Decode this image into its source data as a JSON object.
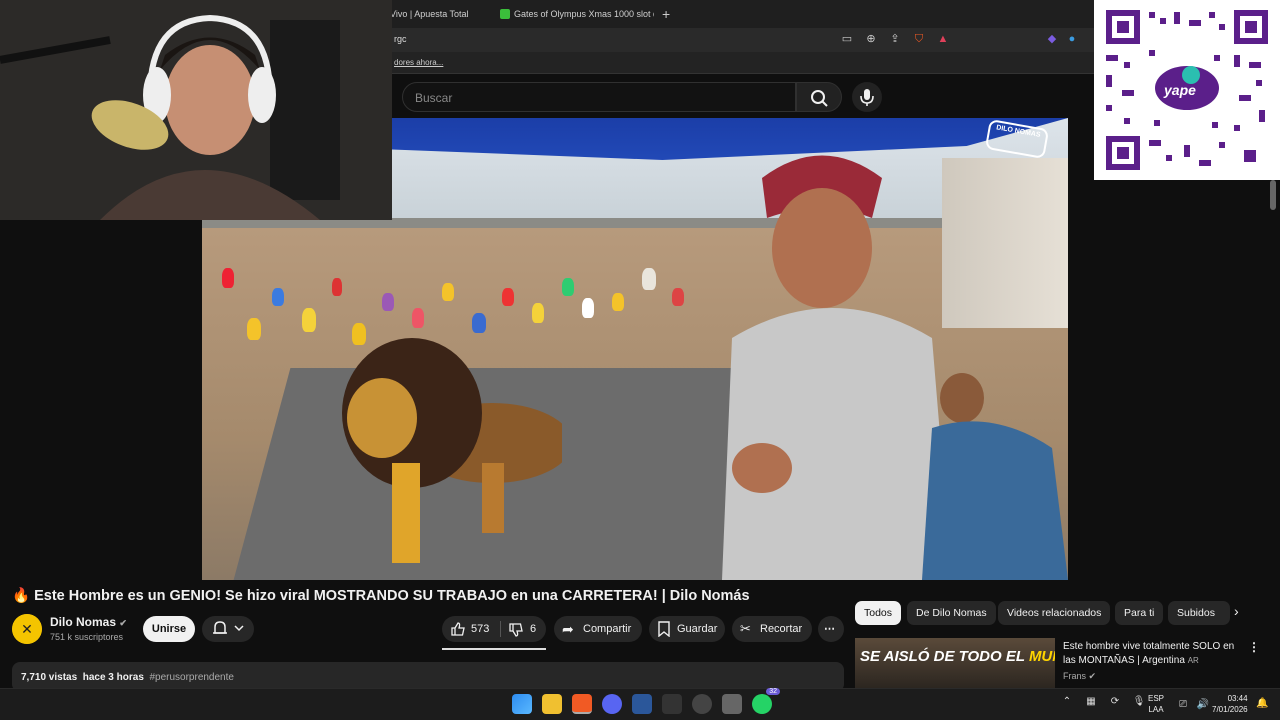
{
  "browser": {
    "tabs": [
      {
        "label": "Vivo | Apuesta Total"
      },
      {
        "label": "Gates of Olympus Xmas 1000 slot de"
      }
    ],
    "address": "rgc",
    "bookmark": "dores ahora..."
  },
  "search": {
    "placeholder": "Buscar"
  },
  "video": {
    "overlay_logo": "DILO NOMAS"
  },
  "title": {
    "emoji": "🔥",
    "text": "Este Hombre es un GENIO! Se hizo viral MOSTRANDO SU TRABAJO en una CARRETERA! | Dilo Nomás"
  },
  "channel": {
    "name": "Dilo Nomas",
    "verified": "✔",
    "subscribers": "751 k suscriptores",
    "join_label": "Unirse"
  },
  "actions": {
    "likes": "573",
    "dislikes": "6",
    "share": "Compartir",
    "save": "Guardar",
    "clip": "Recortar",
    "more": "⋯"
  },
  "description": {
    "views": "7,710 vistas",
    "time": "hace 3 horas",
    "hashtag": "#perusorprendente"
  },
  "chips": [
    "Todos",
    "De Dilo Nomas",
    "Videos relacionados",
    "Para ti",
    "Subidos"
  ],
  "recommended": {
    "thumb_text_a": "SE AISLÓ DE TODO EL",
    "thumb_text_b": "MUNDO",
    "title": "Este hombre vive totalmente SOLO en las MONTAÑAS | Argentina",
    "title_suffix": "AR",
    "channel": "Frans"
  },
  "qr": {
    "brand": "yape"
  },
  "taskbar": {
    "lang_a": "ESP",
    "lang_b": "LAA",
    "time": "03:44",
    "date": "7/01/2026",
    "whatsapp_badge": "32"
  },
  "colors": {
    "accent": "#ff0000",
    "chip_active": "#f1f1f1",
    "background": "#0f0f0f",
    "yape": "#6a1b9a"
  }
}
